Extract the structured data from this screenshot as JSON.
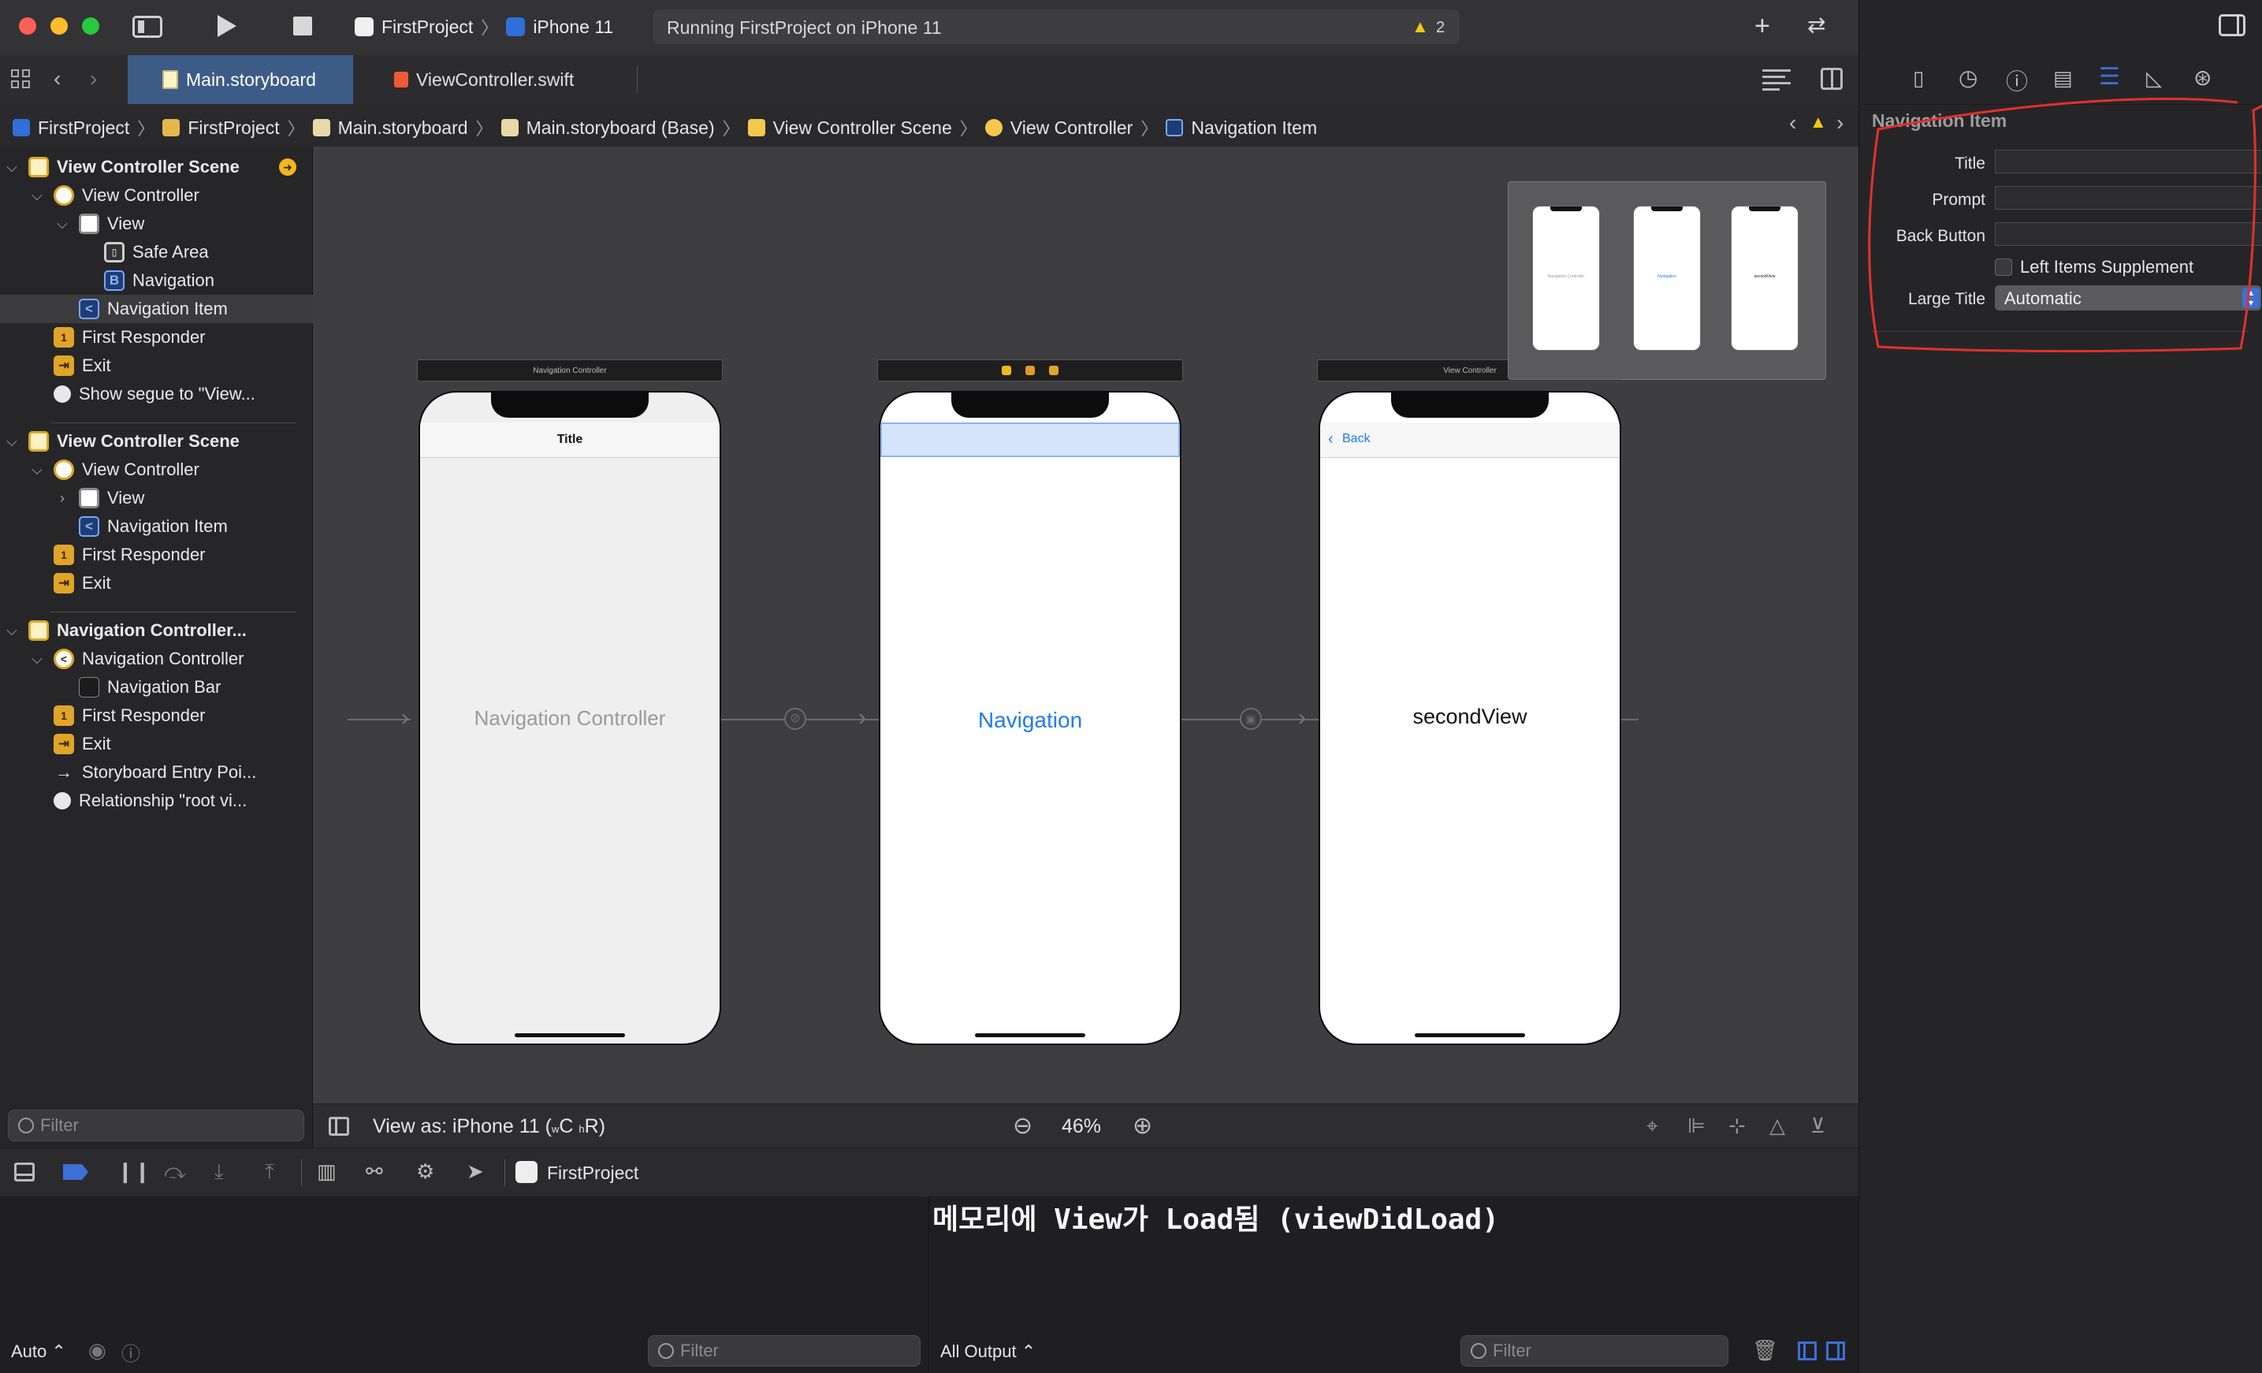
{
  "toolbar": {
    "scheme": "FirstProject",
    "device": "iPhone 11",
    "activity": "Running FirstProject on iPhone 11",
    "warnings": "2"
  },
  "tabs": [
    {
      "label": "Main.storyboard"
    },
    {
      "label": "ViewController.swift"
    }
  ],
  "breadcrumbs": [
    "FirstProject",
    "FirstProject",
    "Main.storyboard",
    "Main.storyboard (Base)",
    "View Controller Scene",
    "View Controller",
    "Navigation Item"
  ],
  "navigator": {
    "rows": [
      {
        "label": "View Controller Scene"
      },
      {
        "label": "View Controller"
      },
      {
        "label": "View"
      },
      {
        "label": "Safe Area"
      },
      {
        "label": "Navigation"
      },
      {
        "label": "Navigation Item"
      },
      {
        "label": "First Responder"
      },
      {
        "label": "Exit"
      },
      {
        "label": "Show segue to \"View..."
      },
      {
        "label": "View Controller Scene"
      },
      {
        "label": "View Controller"
      },
      {
        "label": "View"
      },
      {
        "label": "Navigation Item"
      },
      {
        "label": "First Responder"
      },
      {
        "label": "Exit"
      },
      {
        "label": "Navigation Controller..."
      },
      {
        "label": "Navigation Controller"
      },
      {
        "label": "Navigation Bar"
      },
      {
        "label": "First Responder"
      },
      {
        "label": "Exit"
      },
      {
        "label": "Storyboard Entry Poi..."
      },
      {
        "label": "Relationship \"root vi..."
      }
    ],
    "filter_placeholder": "Filter"
  },
  "canvas": {
    "nav_controller_bar": "Navigation Controller",
    "nav_controller_center": "Navigation Controller",
    "nav_controller_title": "Title",
    "first_vc_label": "Navigation",
    "second_vc_bar": "View Controller",
    "second_vc_back": "Back",
    "second_vc_label": "secondView",
    "minimap": [
      "Navigation Controller",
      "Navigation",
      "secondView"
    ]
  },
  "canvas_bottom": {
    "view_as": "View as: iPhone 11 (",
    "view_as_w": "w",
    "view_as_c": "C",
    "view_as_h": "h",
    "view_as_r": "R)",
    "zoom": "46%"
  },
  "debug": {
    "target": "FirstProject"
  },
  "vars": {
    "scope": "Auto",
    "filter_placeholder": "Filter"
  },
  "console": {
    "output": "메모리에 View가 Load됨 (viewDidLoad)",
    "output_mode": "All Output",
    "filter_placeholder": "Filter"
  },
  "inspector": {
    "header": "Navigation Item",
    "title_label": "Title",
    "prompt_label": "Prompt",
    "back_button_label": "Back Button",
    "left_items_label": "Left Items Supplement",
    "large_title_label": "Large Title",
    "large_title_value": "Automatic",
    "title_value": "",
    "prompt_value": "",
    "back_button_value": ""
  },
  "colors": {
    "accent": "#3d6fd6",
    "annotation": "#e0312c",
    "warning": "#f5c518",
    "link": "#1f7cf0"
  }
}
